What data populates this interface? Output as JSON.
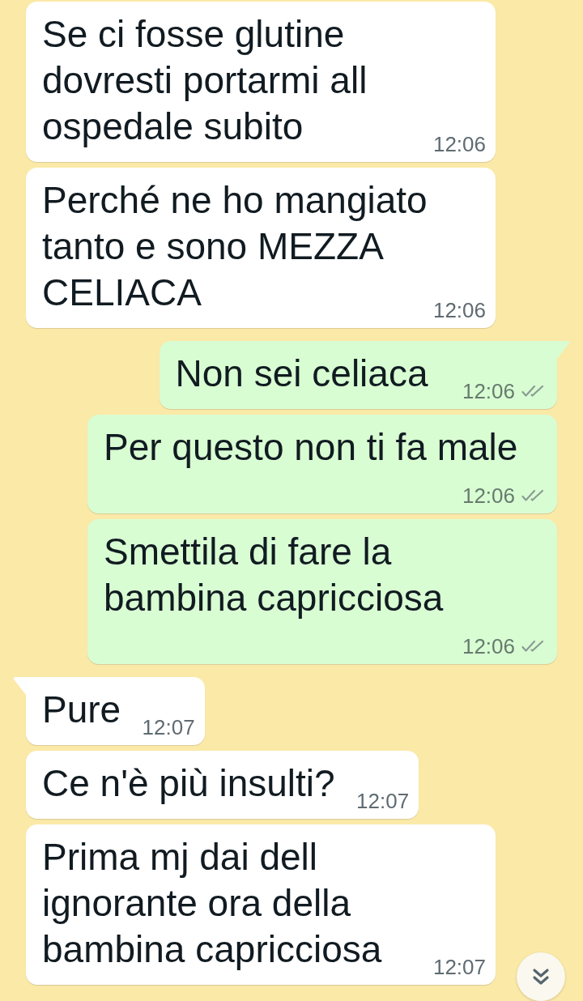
{
  "messages": [
    {
      "kind": "incoming",
      "tail": false,
      "text": "Se ci fosse glutine\ndovresti portarmi all\nospedale subito",
      "time": "12:06"
    },
    {
      "kind": "incoming",
      "tail": false,
      "text": "Perché ne ho mangiato\ntanto e sono MEZZA\nCELIACA",
      "time": "12:06"
    },
    {
      "kind": "outgoing",
      "tail": true,
      "text": "Non sei celiaca",
      "time": "12:06",
      "delivered": true,
      "read": false
    },
    {
      "kind": "outgoing",
      "tail": false,
      "text": "Per questo non ti fa male",
      "time": "12:06",
      "delivered": true,
      "read": false
    },
    {
      "kind": "outgoing",
      "tail": false,
      "text": "Smettila di fare la\nbambina capricciosa",
      "time": "12:06",
      "delivered": true,
      "read": false
    },
    {
      "kind": "incoming",
      "tail": true,
      "text": "Pure",
      "time": "12:07"
    },
    {
      "kind": "incoming",
      "tail": false,
      "text": "Ce n'è più insulti?",
      "time": "12:07"
    },
    {
      "kind": "incoming",
      "tail": false,
      "text": "Prima mj dai dell\nignorante ora della\nbambina capricciosa",
      "time": "12:07"
    }
  ]
}
